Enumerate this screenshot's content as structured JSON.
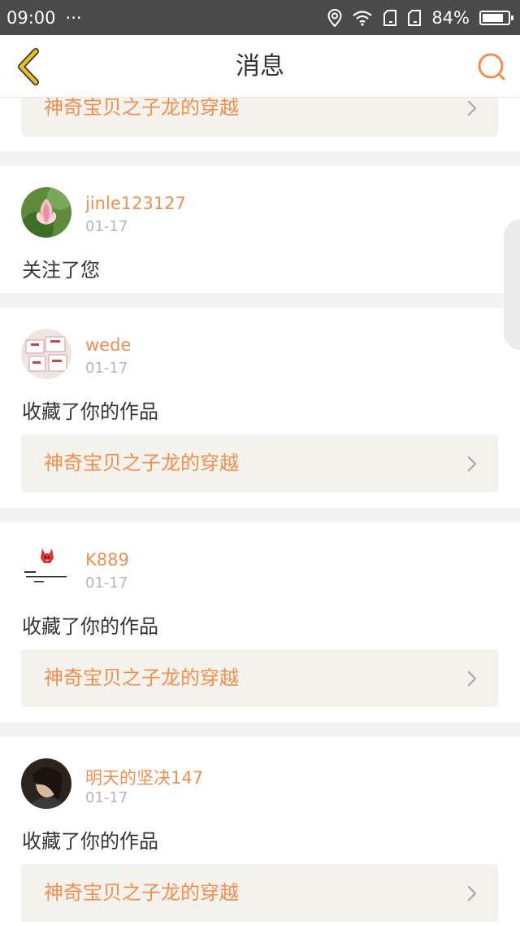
{
  "status_bar": {
    "time": "09:00",
    "dots": "···",
    "battery": "84%",
    "battery_level": 0.84,
    "icons": [
      "location-icon",
      "wifi-icon",
      "sim1-icon",
      "sim2-icon",
      "battery-icon"
    ]
  },
  "header": {
    "title": "消息",
    "back_icon": "chevron-left-icon",
    "search_icon": "search-icon"
  },
  "top_partial_card": {
    "work_title": "神奇宝贝之子龙的穿越"
  },
  "notifications": [
    {
      "username": "jinle123127",
      "date": "01-17",
      "action": "关注了您",
      "avatar": "lotus-avatar"
    },
    {
      "username": "wede",
      "date": "01-17",
      "action": "收藏了你的作品",
      "work_title": "神奇宝贝之子龙的穿越",
      "avatar": "gift-box-avatar"
    },
    {
      "username": "K889",
      "date": "01-17",
      "action": "收藏了你的作品",
      "work_title": "神奇宝贝之子龙的穿越",
      "avatar": "cartoon-fox-avatar"
    },
    {
      "username": "明天的坚决147",
      "date": "01-17",
      "action": "收藏了你的作品",
      "work_title": "神奇宝贝之子龙的穿越",
      "avatar": "portrait-avatar"
    }
  ],
  "colors": {
    "accent": "#f09050",
    "back_icon": "#e8c020",
    "link_bg": "#f3f2ed"
  }
}
